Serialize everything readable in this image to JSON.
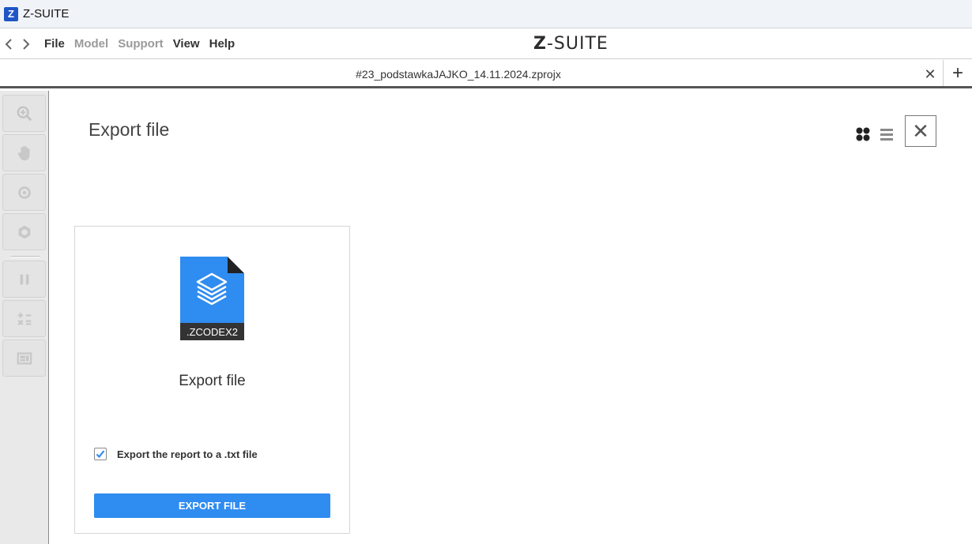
{
  "window": {
    "title": "Z-SUITE",
    "logo_letter": "Z"
  },
  "menubar": {
    "back_icon": "chevron-left-icon",
    "forward_icon": "chevron-right-icon",
    "items": [
      {
        "label": "File",
        "state": "enabled"
      },
      {
        "label": "Model",
        "state": "disabled"
      },
      {
        "label": "Support",
        "state": "disabled"
      },
      {
        "label": "View",
        "state": "enabled"
      },
      {
        "label": "Help",
        "state": "enabled"
      }
    ],
    "brand_prefix": "Z",
    "brand_suffix": "-SUITE"
  },
  "tabs": {
    "active_tab": "#23_podstawkaJAJKO_14.11.2024.zprojx",
    "close_symbol": "✕",
    "add_symbol": "+"
  },
  "toolbar": {
    "tools": [
      "zoom-icon",
      "pan-hand-icon",
      "rotate-icon",
      "view-cube-icon",
      "pause-icon",
      "calculator-icon",
      "layout-icon"
    ]
  },
  "main": {
    "title": "Export file",
    "close_symbol": "✕"
  },
  "card": {
    "file_extension": ".ZCODEX2",
    "title": "Export file",
    "checkbox_label": "Export the report to a .txt file",
    "checkbox_checked": true,
    "button_label": "EXPORT FILE"
  },
  "colors": {
    "accent": "#2f8cf0",
    "file_icon": "#2f8cf0",
    "file_band": "#333333"
  }
}
